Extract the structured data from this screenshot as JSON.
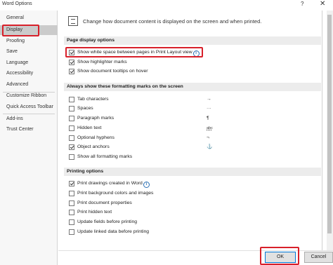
{
  "window": {
    "title": "Word Options",
    "help_label": "?",
    "close_label": "✕"
  },
  "sidebar": {
    "items": [
      {
        "label": "General"
      },
      {
        "label": "Display"
      },
      {
        "label": "Proofing"
      },
      {
        "label": "Save"
      },
      {
        "label": "Language"
      },
      {
        "label": "Accessibility"
      },
      {
        "label": "Advanced"
      },
      {
        "label": "Customize Ribbon"
      },
      {
        "label": "Quick Access Toolbar"
      },
      {
        "label": "Add-ins"
      },
      {
        "label": "Trust Center"
      }
    ],
    "selected": "Display"
  },
  "header": {
    "text": "Change how document content is displayed on the screen and when printed."
  },
  "sections": {
    "page_display": {
      "title": "Page display options",
      "options": [
        {
          "label": "Show white space between pages in Print Layout view",
          "checked": true,
          "info": "i"
        },
        {
          "label": "Show highlighter marks",
          "checked": true
        },
        {
          "label": "Show document tooltips on hover",
          "checked": true
        }
      ]
    },
    "formatting_marks": {
      "title": "Always show these formatting marks on the screen",
      "options": [
        {
          "label": "Tab characters",
          "checked": false,
          "mark": "→"
        },
        {
          "label": "Spaces",
          "checked": false,
          "mark": "···"
        },
        {
          "label": "Paragraph marks",
          "checked": false,
          "mark": "¶"
        },
        {
          "label": "Hidden text",
          "checked": false,
          "mark": "abc"
        },
        {
          "label": "Optional hyphens",
          "checked": false,
          "mark": "¬"
        },
        {
          "label": "Object anchors",
          "checked": true,
          "mark": "⚓"
        },
        {
          "label": "Show all formatting marks",
          "checked": false
        }
      ]
    },
    "printing": {
      "title": "Printing options",
      "options": [
        {
          "label": "Print drawings created in Word",
          "checked": true,
          "info": "i"
        },
        {
          "label": "Print background colors and images",
          "checked": false
        },
        {
          "label": "Print document properties",
          "checked": false
        },
        {
          "label": "Print hidden text",
          "checked": false
        },
        {
          "label": "Update fields before printing",
          "checked": false
        },
        {
          "label": "Update linked data before printing",
          "checked": false
        }
      ]
    }
  },
  "buttons": {
    "ok": "OK",
    "cancel": "Cancel"
  },
  "colors": {
    "highlight": "#d8202a",
    "selected_nav": "#cbcbcb",
    "section_bg": "#ececec",
    "info_blue": "#2a6fb4"
  }
}
